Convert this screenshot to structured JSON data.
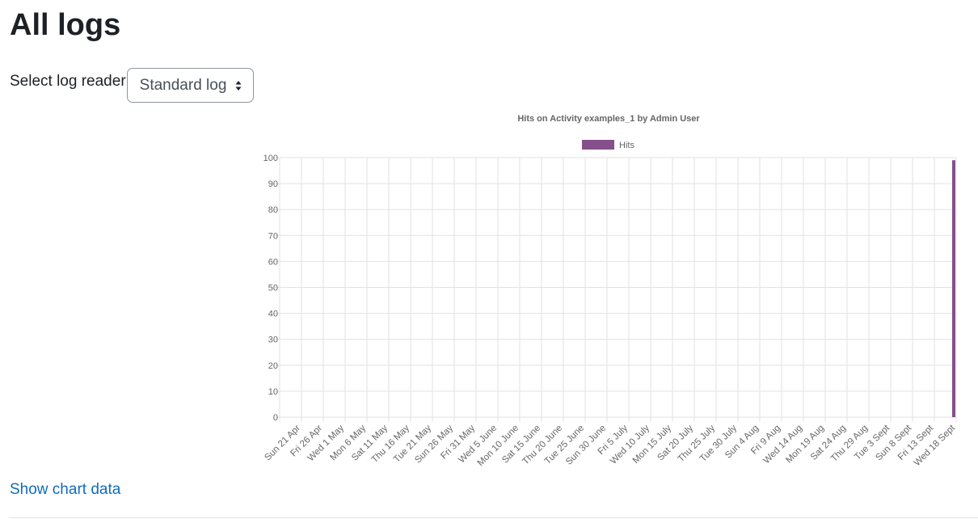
{
  "page": {
    "title": "All logs"
  },
  "reader": {
    "label": "Select log reader",
    "selected": "Standard log"
  },
  "links": {
    "show_chart_data": "Show chart data"
  },
  "colors": {
    "series": "#86508c",
    "link": "#0f6cbf"
  },
  "chart_data": {
    "type": "bar",
    "title": "Hits on Activity examples_1 by Admin User",
    "xlabel": "",
    "ylabel": "",
    "ylim": [
      0,
      100
    ],
    "yticks": [
      0,
      10,
      20,
      30,
      40,
      50,
      60,
      70,
      80,
      90,
      100
    ],
    "grid": true,
    "legend": "top-center",
    "categories": [
      "Sun 21 Apr",
      "Fri 26 Apr",
      "Wed 1 May",
      "Mon 6 May",
      "Sat 11 May",
      "Thu 16 May",
      "Tue 21 May",
      "Sun 26 May",
      "Fri 31 May",
      "Wed 5 June",
      "Mon 10 June",
      "Sat 15 June",
      "Thu 20 June",
      "Tue 25 June",
      "Sun 30 June",
      "Fri 5 July",
      "Wed 10 July",
      "Mon 15 July",
      "Sat 20 July",
      "Thu 25 July",
      "Tue 30 July",
      "Sun 4 Aug",
      "Fri 9 Aug",
      "Wed 14 Aug",
      "Mon 19 Aug",
      "Sat 24 Aug",
      "Thu 29 Aug",
      "Tue 3 Sept",
      "Sun 8 Sept",
      "Fri 13 Sept",
      "Wed 18 Sept"
    ],
    "series": [
      {
        "name": "Hits",
        "color": "#86508c",
        "values": [
          0,
          0,
          0,
          0,
          0,
          0,
          0,
          0,
          0,
          0,
          0,
          0,
          0,
          0,
          0,
          0,
          0,
          0,
          0,
          0,
          0,
          0,
          0,
          0,
          0,
          0,
          0,
          0,
          0,
          0,
          99
        ]
      }
    ]
  }
}
